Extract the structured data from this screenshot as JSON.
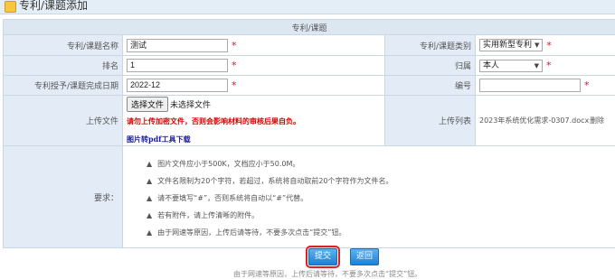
{
  "page": {
    "title": "专利/课题添加"
  },
  "form": {
    "header": "专利/课题",
    "name_label": "专利/课题名称",
    "name_value": "测试",
    "type_label": "专利/课题类别",
    "type_value": "实用新型专利",
    "rank_label": "排名",
    "rank_value": "1",
    "belong_label": "归属",
    "belong_value": "本人",
    "date_label": "专利授予/课题完成日期",
    "date_value": "2022-12",
    "number_label": "编号",
    "number_value": "",
    "upload_label": "上传文件",
    "choose_file": "选择文件",
    "no_file": "未选择文件",
    "upload_warning": "请勿上传加密文件，否则会影响材料的审核后果自负。",
    "pdf_tool_link": "图片转pdf工具下载",
    "upload_list_label": "上传列表",
    "uploaded_file": "2023年系统优化需求-0307.docx",
    "delete_label": "删除",
    "req_label": "要求：",
    "requirements": [
      "图片文件应小于500K，文档应小于50.0M。",
      "文件名限制为20个字符，若超过，系统将自动取前20个字符作为文件名。",
      "请不要填写“#”，否则系统将自动以“#”代替。",
      "若有附件，请上传清晰的附件。",
      "由于网速等原因，上传后请等待，不要多次点击“提交”钮。"
    ]
  },
  "buttons": {
    "submit": "提交",
    "back": "返回"
  },
  "footer": "由于网速等原因，上传后请等待，不要多次点击“提交”钮。"
}
